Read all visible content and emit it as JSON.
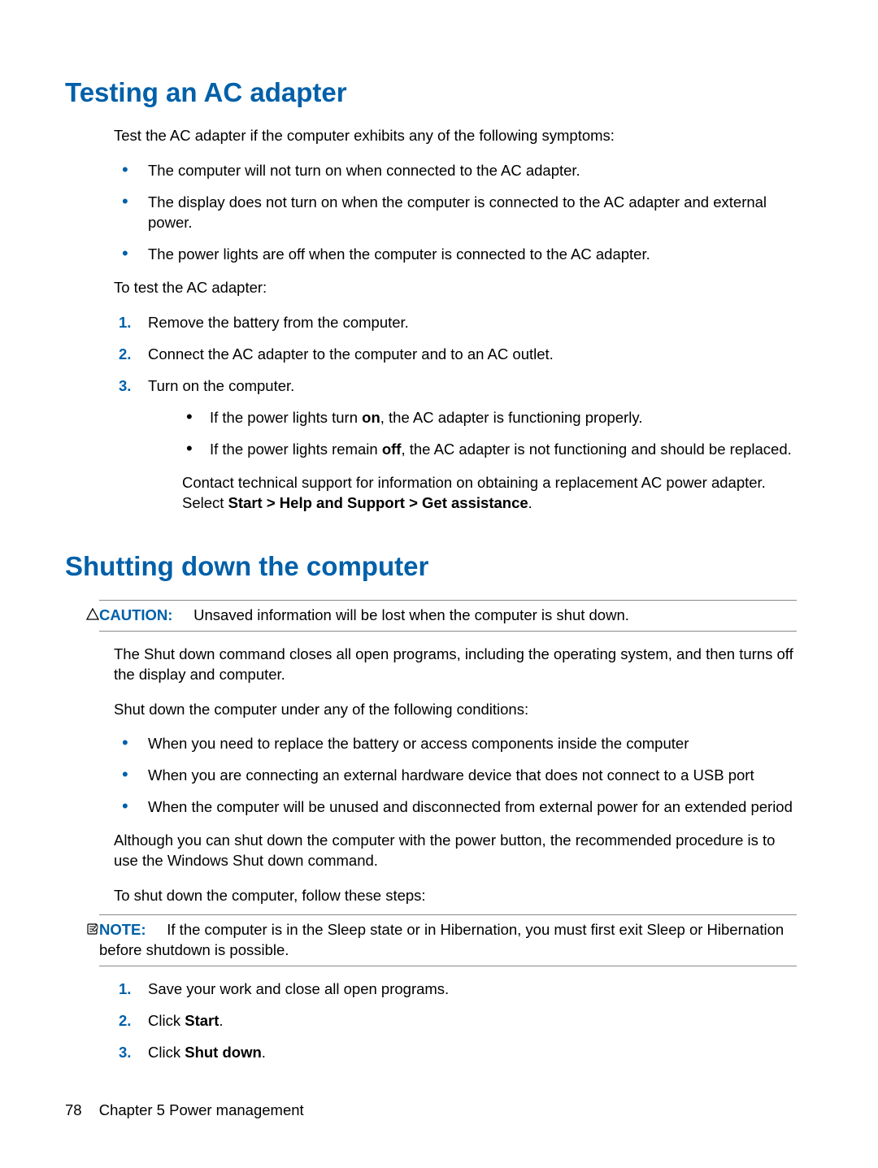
{
  "section1": {
    "title": "Testing an AC adapter",
    "intro": "Test the AC adapter if the computer exhibits any of the following symptoms:",
    "symptoms": [
      "The computer will not turn on when connected to the AC adapter.",
      "The display does not turn on when the computer is connected to the AC adapter and external power.",
      "The power lights are off when the computer is connected to the AC adapter."
    ],
    "testIntro": "To test the AC adapter:",
    "steps": {
      "s1": "Remove the battery from the computer.",
      "s2": "Connect the AC adapter to the computer and to an AC outlet.",
      "s3": "Turn on the computer.",
      "sub1_pre": "If the power lights turn ",
      "sub1_bold": "on",
      "sub1_post": ", the AC adapter is functioning properly.",
      "sub2_pre": "If the power lights remain ",
      "sub2_bold": "off",
      "sub2_post": ", the AC adapter is not functioning and should be replaced.",
      "followup_pre": "Contact technical support for information on obtaining a replacement AC power adapter. Select ",
      "followup_bold": "Start > Help and Support > Get assistance",
      "followup_post": "."
    }
  },
  "section2": {
    "title": "Shutting down the computer",
    "caution_label": "CAUTION:",
    "caution_text": "Unsaved information will be lost when the computer is shut down.",
    "p1": "The Shut down command closes all open programs, including the operating system, and then turns off the display and computer.",
    "p2": "Shut down the computer under any of the following conditions:",
    "conditions": [
      "When you need to replace the battery or access components inside the computer",
      "When you are connecting an external hardware device that does not connect to a USB port",
      "When the computer will be unused and disconnected from external power for an extended period"
    ],
    "p3": "Although you can shut down the computer with the power button, the recommended procedure is to use the Windows Shut down command.",
    "p4": "To shut down the computer, follow these steps:",
    "note_label": "NOTE:",
    "note_text": "If the computer is in the Sleep state or in Hibernation, you must first exit Sleep or Hibernation before shutdown is possible.",
    "steps": {
      "s1": "Save your work and close all open programs.",
      "s2_pre": "Click ",
      "s2_bold": "Start",
      "s2_post": ".",
      "s3_pre": "Click ",
      "s3_bold": "Shut down",
      "s3_post": "."
    }
  },
  "footer": {
    "page": "78",
    "chapter": "Chapter 5   Power management"
  }
}
